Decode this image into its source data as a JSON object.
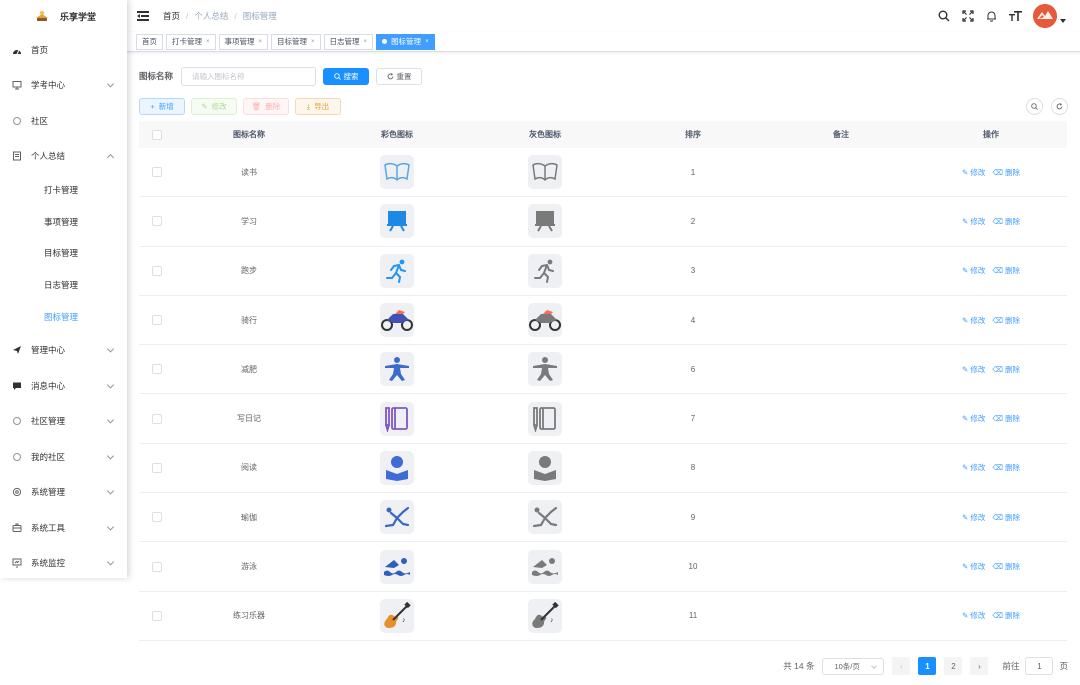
{
  "app": {
    "name": "乐享学堂"
  },
  "sidebar": {
    "items": [
      {
        "label": "首页",
        "icon": "dashboard-icon",
        "chevron": false
      },
      {
        "label": "学考中心",
        "icon": "monitor-icon",
        "chevron": true
      },
      {
        "label": "社区",
        "icon": "community-icon",
        "chevron": false
      },
      {
        "label": "个人总结",
        "icon": "document-icon",
        "chevron": true,
        "expanded": true,
        "children": [
          {
            "label": "打卡管理"
          },
          {
            "label": "事项管理"
          },
          {
            "label": "目标管理"
          },
          {
            "label": "日志管理"
          },
          {
            "label": "图标管理",
            "active": true
          }
        ]
      },
      {
        "label": "管理中心",
        "icon": "send-icon",
        "chevron": true
      },
      {
        "label": "消息中心",
        "icon": "message-icon",
        "chevron": true
      },
      {
        "label": "社区管理",
        "icon": "community-admin-icon",
        "chevron": true
      },
      {
        "label": "我的社区",
        "icon": "my-community-icon",
        "chevron": true
      },
      {
        "label": "系统管理",
        "icon": "system-icon",
        "chevron": true
      },
      {
        "label": "系统工具",
        "icon": "tool-icon",
        "chevron": true
      },
      {
        "label": "系统监控",
        "icon": "monitor-screen-icon",
        "chevron": true
      }
    ]
  },
  "breadcrumb": [
    "首页",
    "个人总结",
    "图标管理"
  ],
  "tags": [
    {
      "label": "首页",
      "closable": false
    },
    {
      "label": "打卡管理",
      "closable": true
    },
    {
      "label": "事项管理",
      "closable": true
    },
    {
      "label": "目标管理",
      "closable": true
    },
    {
      "label": "日志管理",
      "closable": true
    },
    {
      "label": "图标管理",
      "closable": true,
      "active": true
    }
  ],
  "search": {
    "label": "图标名称",
    "placeholder": "请输入图标名称",
    "search_btn": "搜索",
    "reset_btn": "重置"
  },
  "toolbar": {
    "add": "新增",
    "edit": "修改",
    "delete": "删除",
    "export": "导出"
  },
  "table": {
    "headers": [
      "图标名称",
      "彩色图标",
      "灰色图标",
      "排序",
      "备注",
      "操作"
    ],
    "op_edit": "修改",
    "op_delete": "删除",
    "rows": [
      {
        "name": "读书",
        "sort": "1",
        "icon": "book-icon",
        "color": "#5aa6e6"
      },
      {
        "name": "学习",
        "sort": "2",
        "icon": "study-board-icon",
        "color": "#1e88e5"
      },
      {
        "name": "跑步",
        "sort": "3",
        "icon": "running-icon",
        "color": "#2196f3"
      },
      {
        "name": "骑行",
        "sort": "4",
        "icon": "motorcycle-icon",
        "color": "#3f51b5"
      },
      {
        "name": "减肥",
        "sort": "6",
        "icon": "fitness-icon",
        "color": "#3b6bc9"
      },
      {
        "name": "写日记",
        "sort": "7",
        "icon": "diary-icon",
        "color": "#7e57c2"
      },
      {
        "name": "阅读",
        "sort": "8",
        "icon": "reading-person-icon",
        "color": "#3f6ad8"
      },
      {
        "name": "瑜伽",
        "sort": "9",
        "icon": "yoga-icon",
        "color": "#3a66c4"
      },
      {
        "name": "游泳",
        "sort": "10",
        "icon": "swimming-icon",
        "color": "#2f5fb8"
      },
      {
        "name": "练习乐器",
        "sort": "11",
        "icon": "guitar-icon",
        "color": "#e6902a"
      }
    ]
  },
  "pagination": {
    "total": "共 14 条",
    "page_size": "10条/页",
    "pages": [
      "1",
      "2"
    ],
    "current": "1",
    "goto_label": "前往",
    "goto_value": "1",
    "page_unit": "页"
  },
  "colors": {
    "primary": "#1890ff",
    "link": "#409eff",
    "avatar": "#e65a3c",
    "gray_icon": "#7a7a7a"
  }
}
